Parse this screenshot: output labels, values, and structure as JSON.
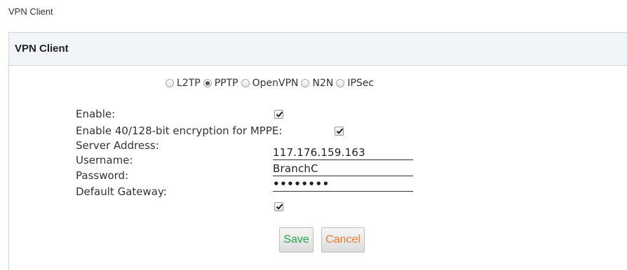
{
  "breadcrumb": "VPN Client",
  "panel": {
    "title": "VPN Client"
  },
  "protocols": [
    {
      "label": "L2TP",
      "selected": false
    },
    {
      "label": "PPTP",
      "selected": true
    },
    {
      "label": "OpenVPN",
      "selected": false
    },
    {
      "label": "N2N",
      "selected": false
    },
    {
      "label": "IPSec",
      "selected": false
    }
  ],
  "form": {
    "enable": {
      "label": "Enable:",
      "checked": true
    },
    "encryption": {
      "label": "Enable 40/128-bit encryption for MPPE:",
      "checked": true
    },
    "server_address": {
      "label": "Server Address:",
      "value": "117.176.159.163"
    },
    "username": {
      "label": "Username:",
      "value": "BranchC"
    },
    "password": {
      "label": "Password:",
      "value": "••••••••"
    },
    "default_gateway": {
      "label": "Default Gateway:",
      "checked": true
    }
  },
  "buttons": {
    "save": {
      "label": "Save",
      "color": "#2aa14a"
    },
    "cancel": {
      "label": "Cancel",
      "color": "#f07b2a"
    }
  }
}
